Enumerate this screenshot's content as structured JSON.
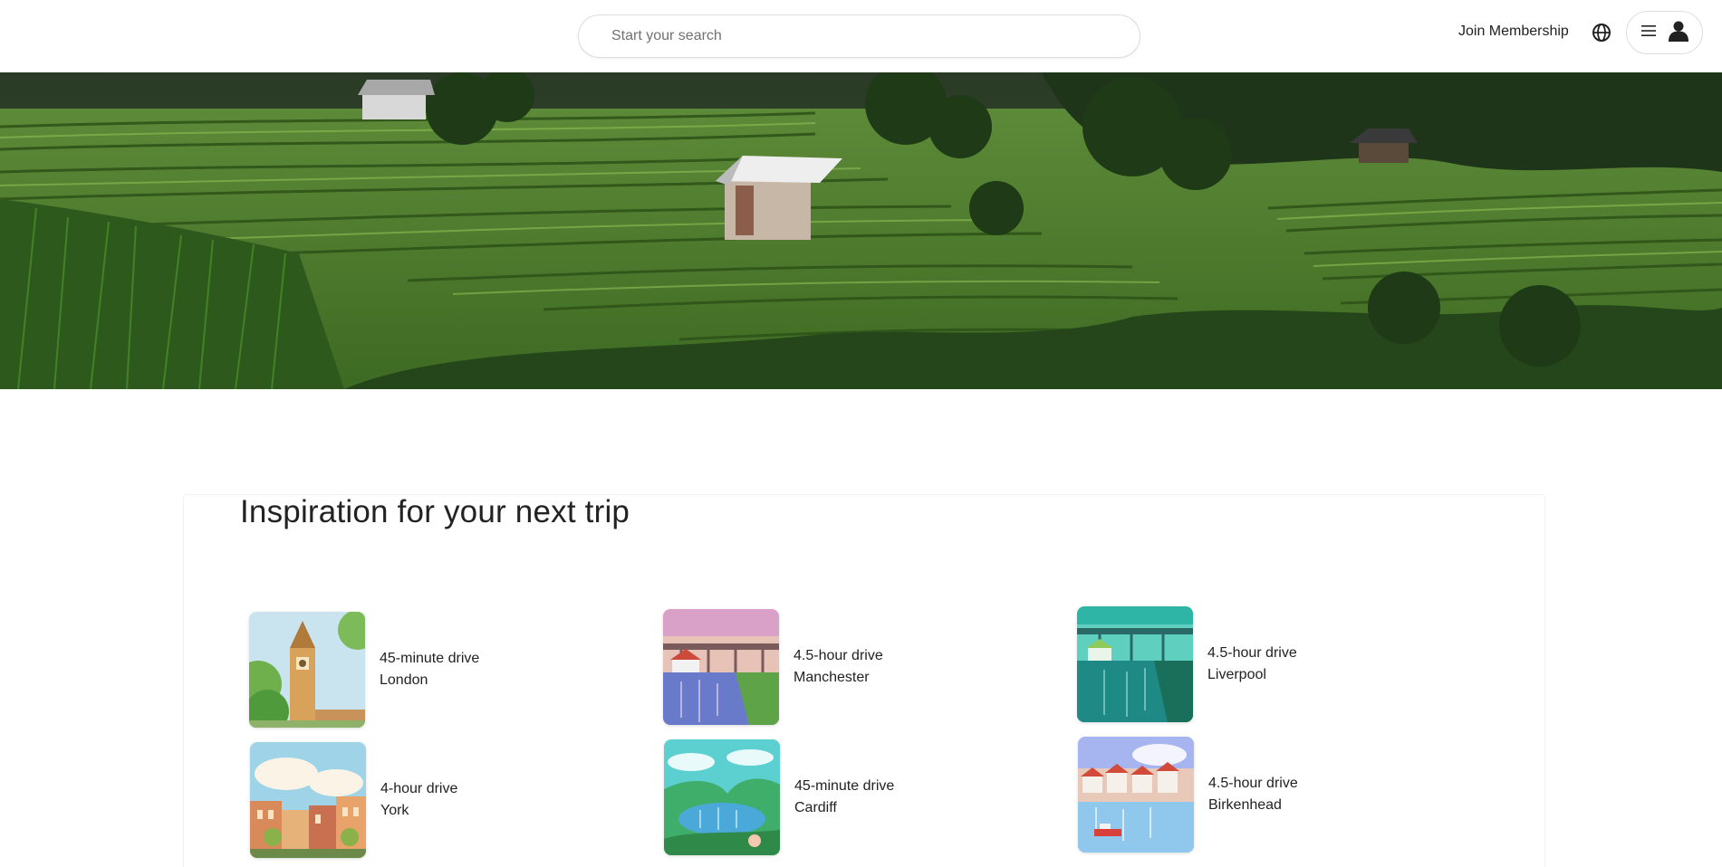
{
  "header": {
    "search_placeholder": "Start your search",
    "join_label": "Join Membership",
    "globe_icon": "globe-icon",
    "menu_icon": "hamburger-menu-icon",
    "user_icon": "user-icon"
  },
  "hero": {
    "image": "terraced rice fields with huts"
  },
  "inspiration": {
    "title": "Inspiration for your next trip",
    "destinations": [
      {
        "drive": "45-minute drive",
        "city": "London"
      },
      {
        "drive": "4.5-hour drive",
        "city": "Manchester"
      },
      {
        "drive": "4.5-hour drive",
        "city": "Liverpool"
      },
      {
        "drive": "4-hour drive",
        "city": "York"
      },
      {
        "drive": "45-minute drive",
        "city": "Cardiff"
      },
      {
        "drive": "4.5-hour drive",
        "city": "Birkenhead"
      }
    ]
  },
  "colors": {
    "text": "#222222",
    "muted": "#717171",
    "border": "#dddddd"
  }
}
